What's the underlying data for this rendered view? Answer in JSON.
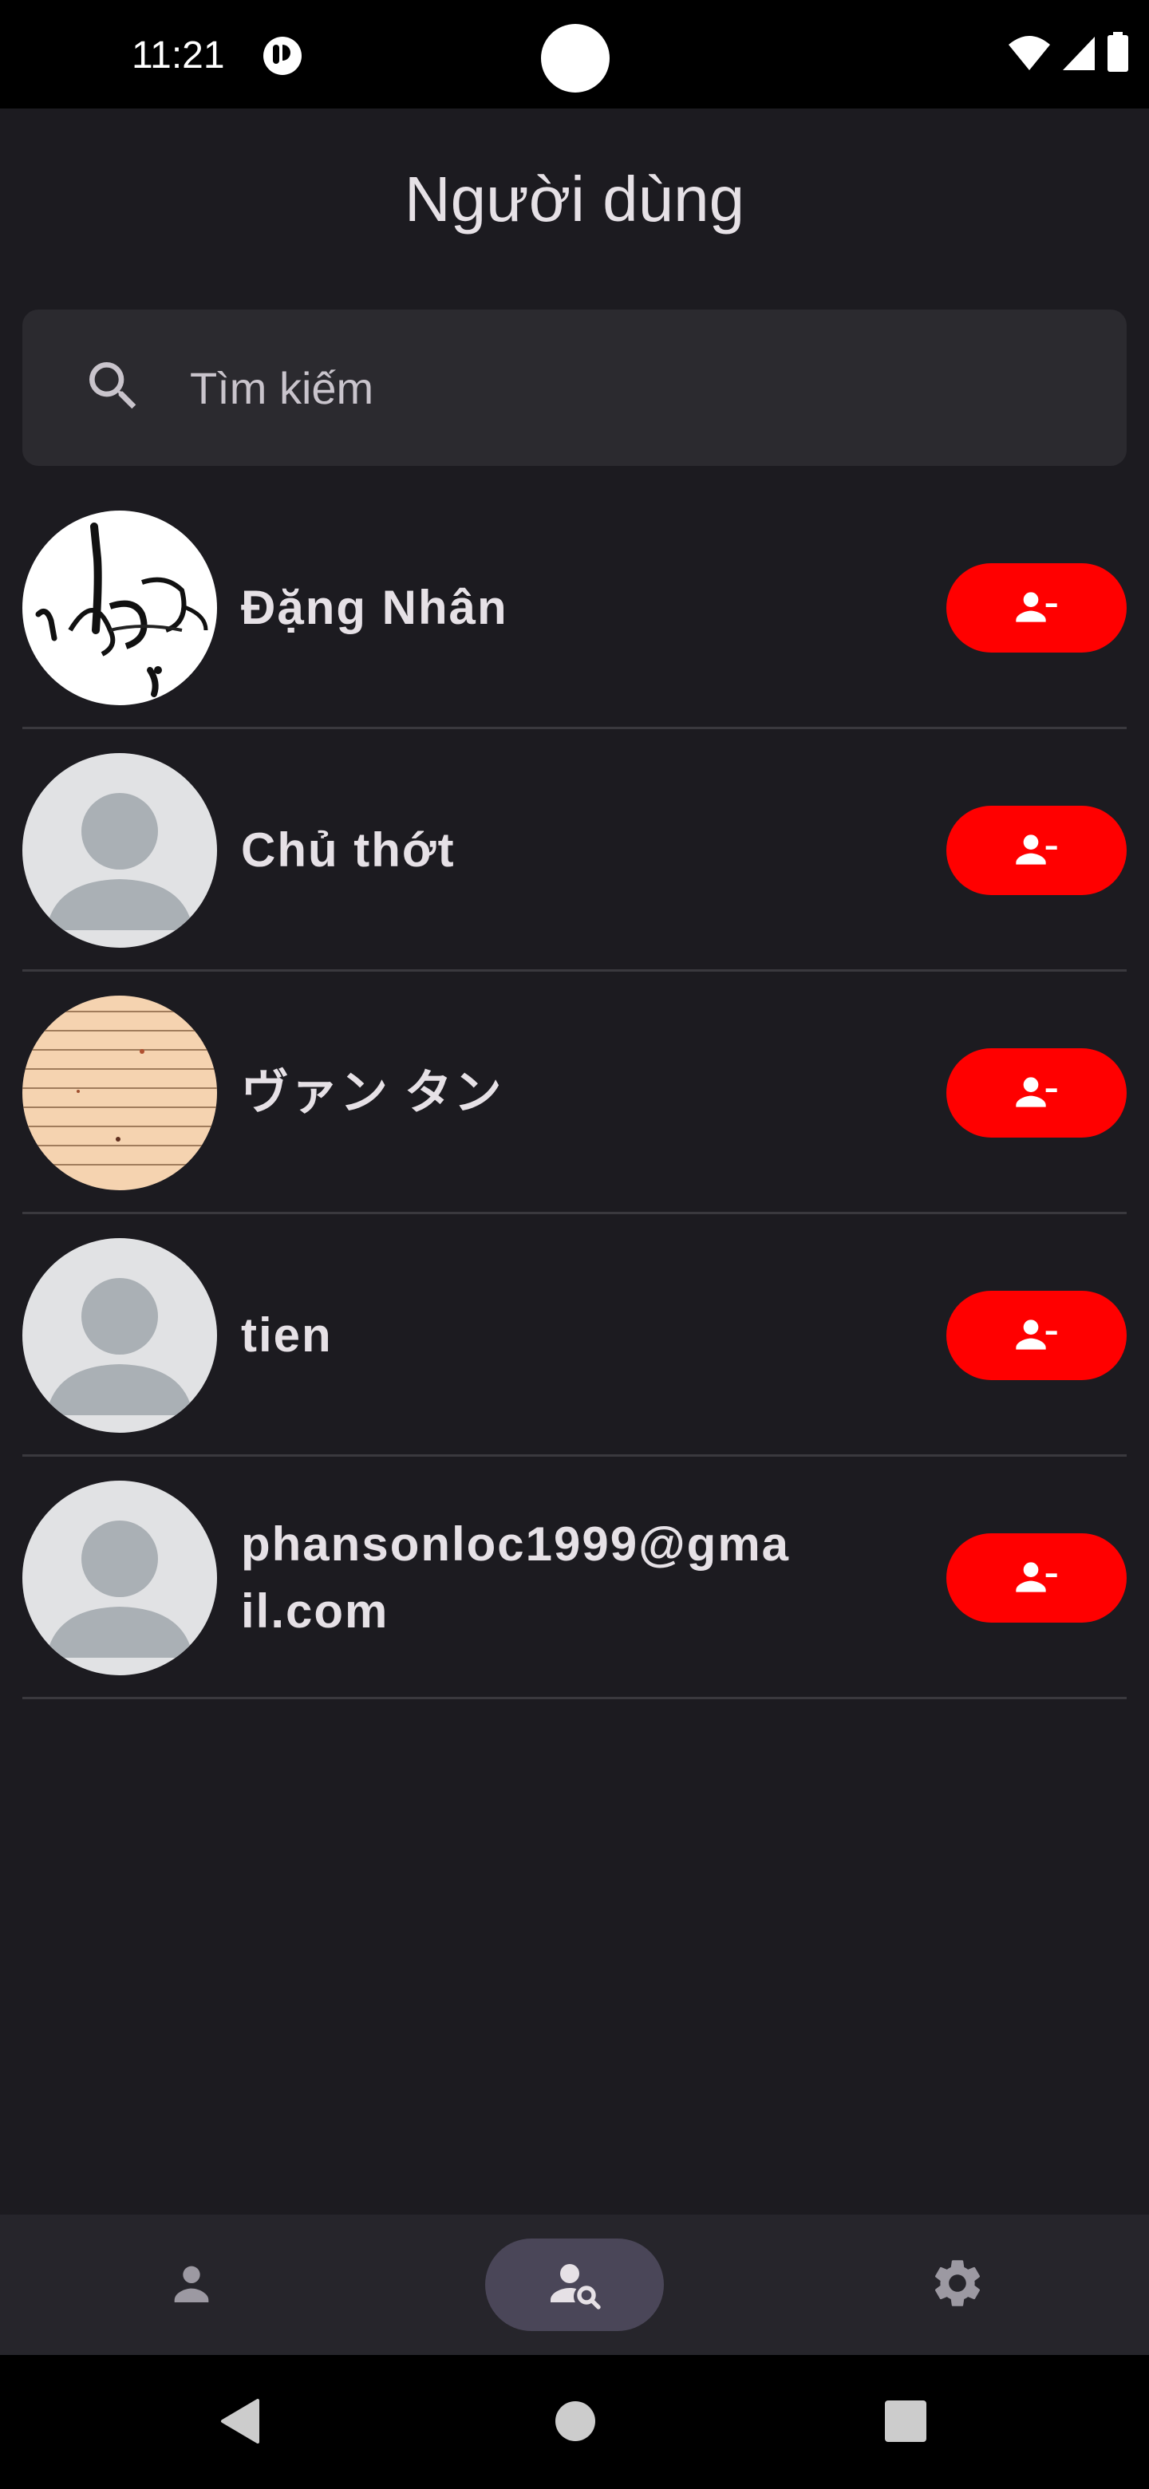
{
  "status_bar": {
    "time": "11:21"
  },
  "header": {
    "title": "Người dùng"
  },
  "search": {
    "placeholder": "Tìm kiếm",
    "value": ""
  },
  "users": [
    {
      "name": "Đặng Nhân",
      "avatar": "calligraphy-image"
    },
    {
      "name": "Chủ thớt",
      "avatar": "default-person"
    },
    {
      "name": "ヴァン タン",
      "avatar": "wood-texture-image"
    },
    {
      "name": "tien",
      "avatar": "default-person"
    },
    {
      "name": "phansonloc1999@gmail.com",
      "avatar": "default-person"
    }
  ],
  "actions": {
    "remove_friend_icon": "person-remove-icon",
    "button_color": "#ff0000"
  },
  "bottom_nav": {
    "items": [
      {
        "icon": "person-icon",
        "active": false
      },
      {
        "icon": "person-search-icon",
        "active": true
      },
      {
        "icon": "gear-icon",
        "active": false
      }
    ]
  },
  "colors": {
    "background": "#1c1b20",
    "accent_active": "#4a4658",
    "danger": "#ff0000"
  }
}
